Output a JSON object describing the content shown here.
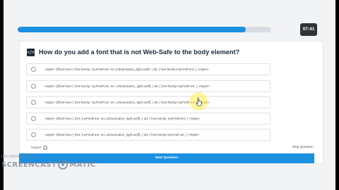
{
  "timer": {
    "value": "07:41"
  },
  "progress": {
    "fraction": 0.9
  },
  "question": {
    "icon": "code-icon",
    "icon_text": "</>",
    "text": "How do you add a font that is not Web-Safe to the body element?"
  },
  "options": [
    {
      "text": "<style> @font-face { font-family: myFirstFont; src:url(sansation_light.woff); } div { font-family:myFirstFont; } </style>"
    },
    {
      "text": "<style> @font-face { font-family: myFirstFont; src: url(sansation_light.woff); } div { font-family:myFirstFont; } </style>"
    },
    {
      "text": "<style> @font-face { font-family: myFirstFont; src: url(sansation_light.woff); } div { font-family:myFirstFont; } </style>"
    },
    {
      "text": "<style> @font-face { font: myFirstFont; src:url(sansation_light.woff); } div { font-family: myFirstFont; } </style>"
    },
    {
      "text": "<style> @font-face { font: myFirstFont; src:url(sansation_light.woff); } div { font-family:myFirstFont; } </style>"
    }
  ],
  "footer": {
    "report_label": "Report",
    "skip_label": "Skip Question",
    "next_label": "Next Question"
  },
  "watermark": {
    "top": "RECORDED WITH",
    "main_left": "SCREENCAST",
    "main_right": "MATIC"
  },
  "colors": {
    "accent": "#1b8fe0",
    "timer_bg": "#2f3337",
    "highlight": "#fff050"
  }
}
